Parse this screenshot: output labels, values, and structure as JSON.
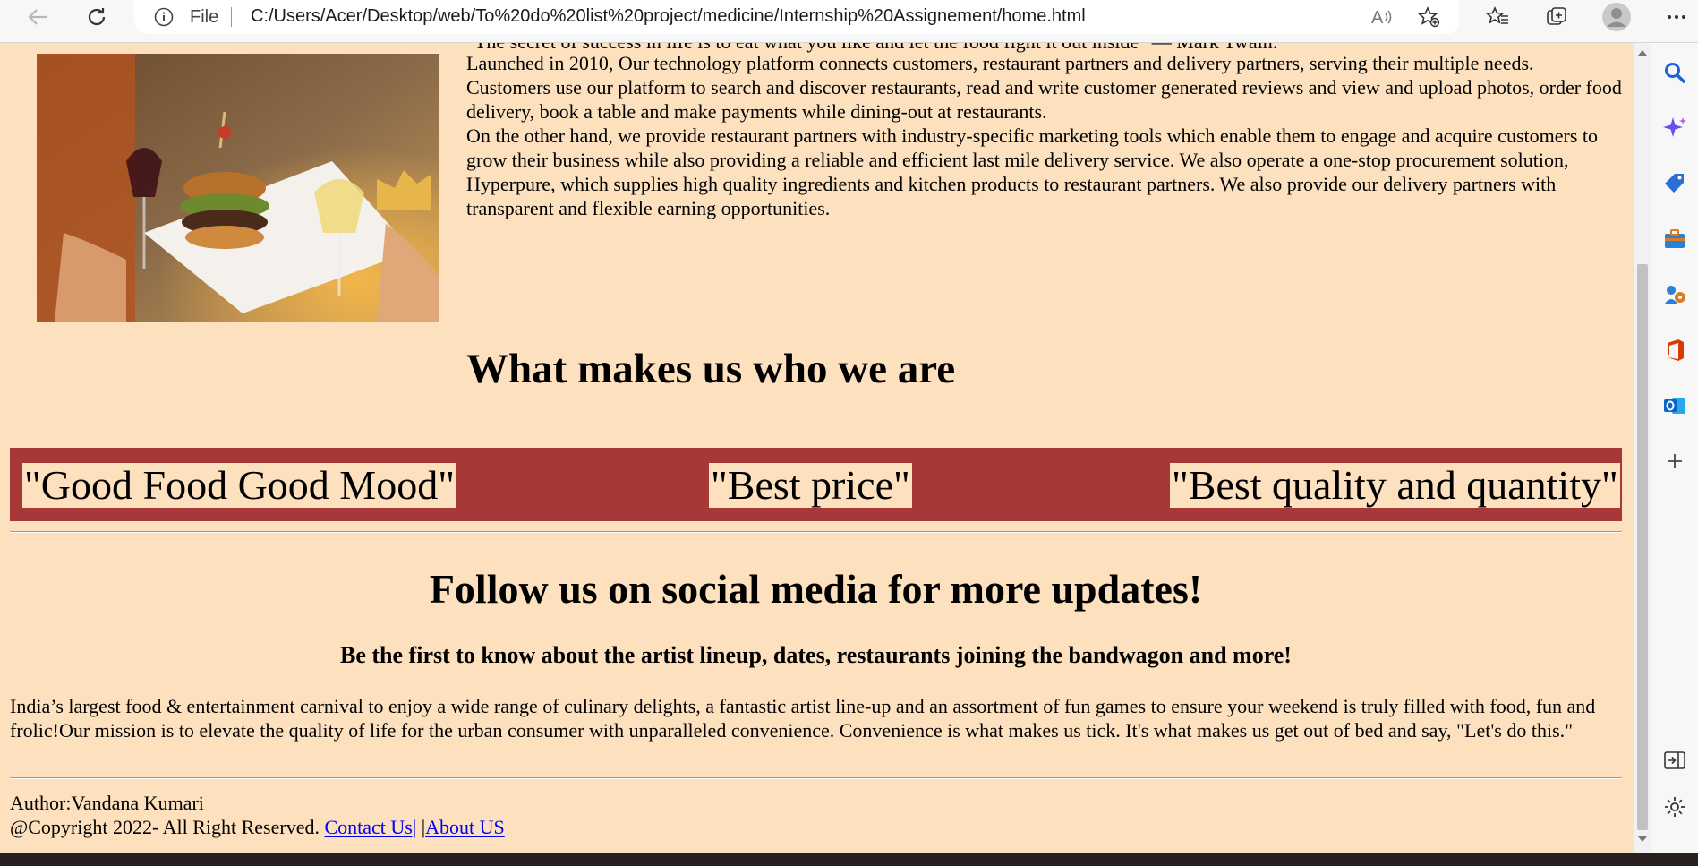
{
  "browser": {
    "address_prefix": "File",
    "url": "C:/Users/Acer/Desktop/web/To%20do%20list%20project/medicine/Internship%20Assignement/home.html",
    "toolbar_icons": [
      "back-icon",
      "refresh-icon",
      "info-icon",
      "read-aloud-icon",
      "add-favorite-icon",
      "favorites-icon",
      "collections-icon",
      "profile-icon",
      "more-icon"
    ]
  },
  "sidebar": {
    "icons": [
      "search-icon",
      "copilot-icon",
      "shopping-tag-icon",
      "tools-icon",
      "games-icon",
      "office-icon",
      "outlook-icon",
      "add-icon",
      "hide-sidebar-icon",
      "settings-icon"
    ]
  },
  "page": {
    "quote_partial": "\"The secret of success in life is to eat what you like and let the food fight it out inside\" — Mark Twain.",
    "about_paragraph_1": "Launched in 2010, Our technology platform connects customers, restaurant partners and delivery partners, serving their multiple needs. Customers use our platform to search and discover restaurants, read and write customer generated reviews and view and upload photos, order food delivery, book a table and make payments while dining-out at restaurants.",
    "about_paragraph_2": "On the other hand, we provide restaurant partners with industry-specific marketing tools which enable them to engage and acquire customers to grow their business while also providing a reliable and efficient last mile delivery service. We also operate a one-stop procurement solution, Hyperpure, which supplies high quality ingredients and kitchen products to restaurant partners. We also provide our delivery partners with transparent and flexible earning opportunities.",
    "section_heading": "What makes us who we are",
    "slogans": [
      "\"Good Food Good Mood\"",
      "\"Best price\"",
      "\"Best quality and quantity\""
    ],
    "follow_heading": "Follow us on social media for more updates!",
    "follow_subheading": "Be the first to know about the artist lineup, dates, restaurants joining the bandwagon and more!",
    "description": "India’s largest food & entertainment carnival to enjoy a wide range of culinary delights, a fantastic artist line-up and an assortment of fun games to ensure your weekend is truly filled with food, fun and frolic!Our mission is to elevate the quality of life for the urban consumer with unparalleled convenience. Convenience is what makes us tick. It's what makes us get out of bed and say, \"Let's do this.\"",
    "footer": {
      "author": "Author:Vandana Kumari",
      "copyright": "@Copyright 2022- All Right Reserved. ",
      "contact_link": "Contact Us|",
      "separator": " |",
      "about_link": "About US"
    }
  },
  "colors": {
    "page_background": "#fde1bf",
    "slogan_band": "#a83838",
    "link": "#0000ee"
  }
}
